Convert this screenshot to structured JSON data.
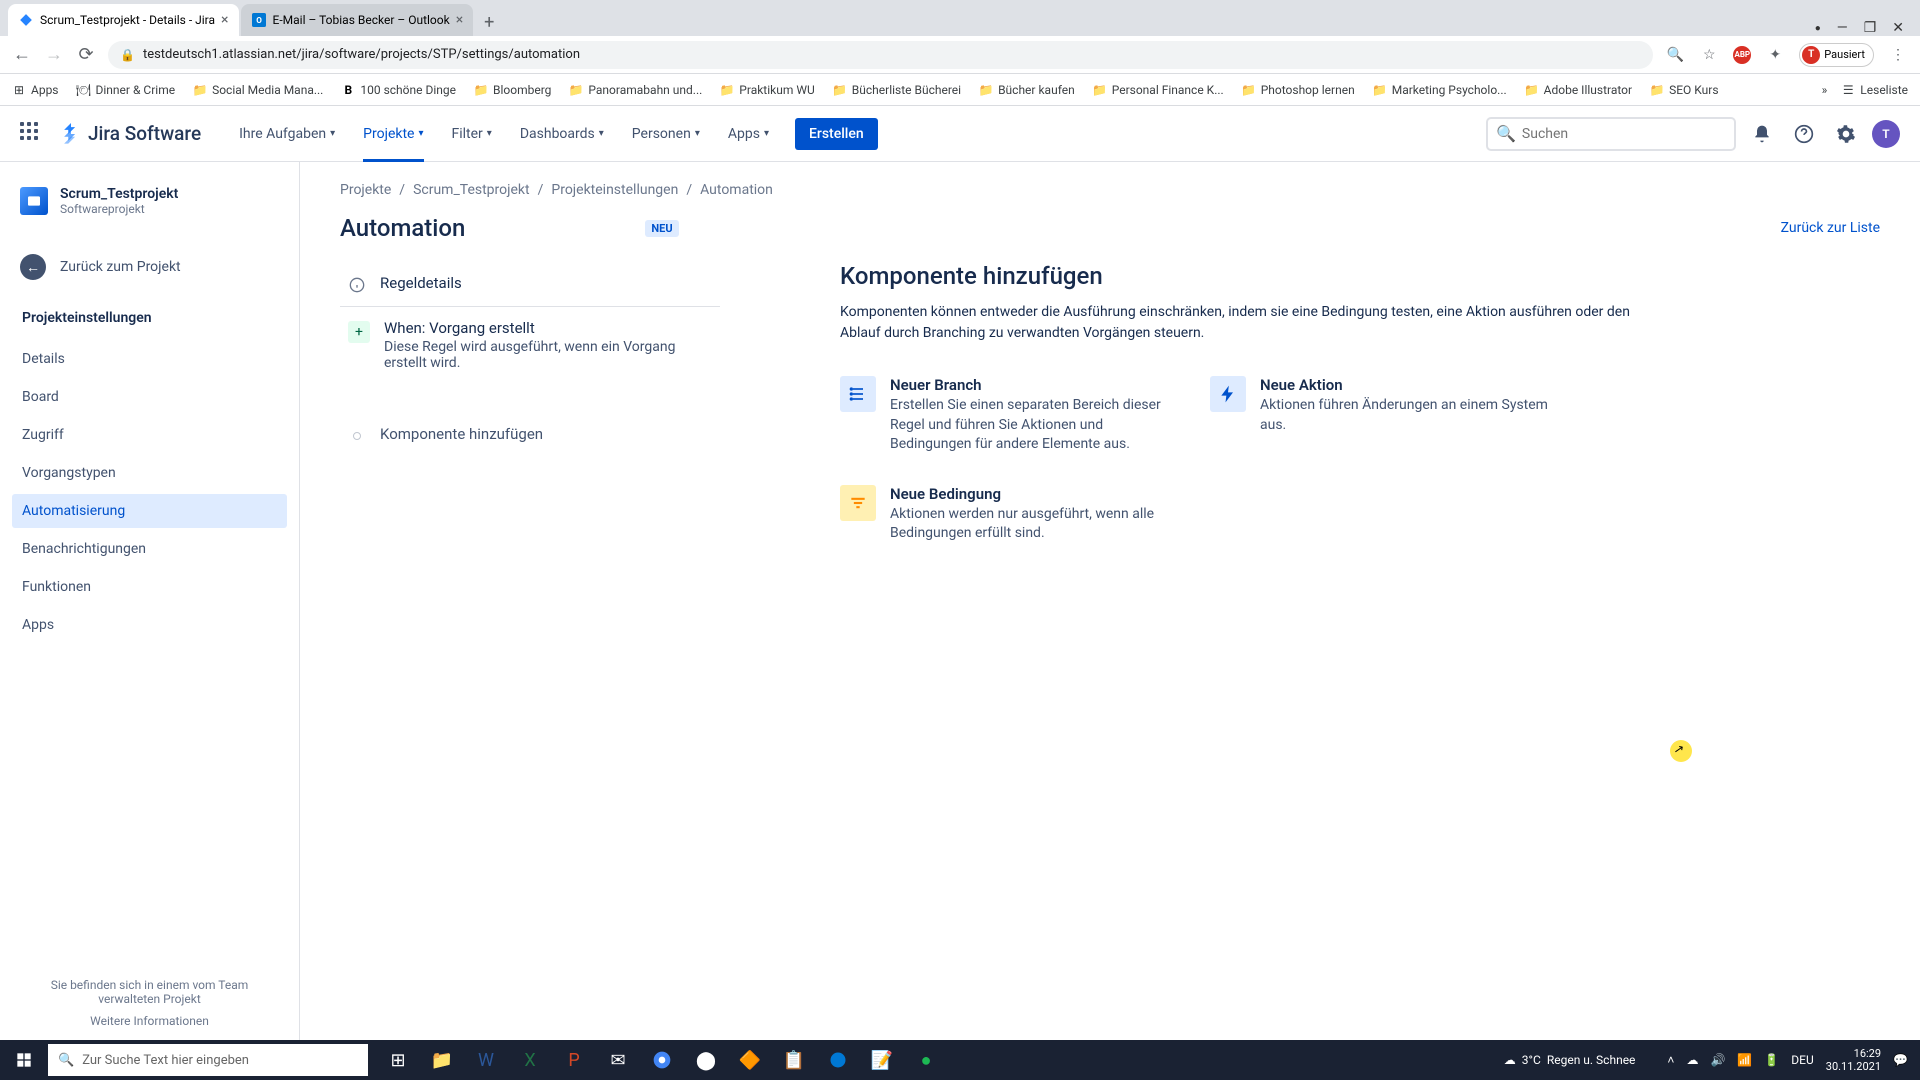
{
  "browser": {
    "tabs": [
      {
        "title": "Scrum_Testprojekt - Details - Jira"
      },
      {
        "title": "E-Mail – Tobias Becker – Outlook"
      }
    ],
    "url": "testdeutsch1.atlassian.net/jira/software/projects/STP/settings/automation",
    "profile_status": "Pausiert",
    "bookmarks": [
      "Apps",
      "Dinner & Crime",
      "Social Media Mana...",
      "100 schöne Dinge",
      "Bloomberg",
      "Panoramabahn und...",
      "Praktikum WU",
      "Bücherliste Bücherei",
      "Bücher kaufen",
      "Personal Finance K...",
      "Photoshop lernen",
      "Marketing Psycholo...",
      "Adobe Illustrator",
      "SEO Kurs"
    ],
    "reading_list": "Leseliste"
  },
  "header": {
    "logo": "Jira Software",
    "nav": [
      "Ihre Aufgaben",
      "Projekte",
      "Filter",
      "Dashboards",
      "Personen",
      "Apps"
    ],
    "active_nav_index": 1,
    "create": "Erstellen",
    "search_placeholder": "Suchen",
    "avatar_initial": "T"
  },
  "sidebar": {
    "project_name": "Scrum_Testprojekt",
    "project_type": "Softwareprojekt",
    "back": "Zurück zum Projekt",
    "section": "Projekteinstellungen",
    "items": [
      "Details",
      "Board",
      "Zugriff",
      "Vorgangstypen",
      "Automatisierung",
      "Benachrichtigungen",
      "Funktionen",
      "Apps"
    ],
    "active_index": 4,
    "footer_line": "Sie befinden sich in einem vom Team verwalteten Projekt",
    "footer_link": "Weitere Informationen"
  },
  "breadcrumb": [
    "Projekte",
    "Scrum_Testprojekt",
    "Projekteinstellungen",
    "Automation"
  ],
  "page": {
    "title": "Automation",
    "badge": "NEU",
    "back_to_list": "Zurück zur Liste"
  },
  "rule": {
    "details_label": "Regeldetails",
    "trigger_title": "When: Vorgang erstellt",
    "trigger_desc": "Diese Regel wird ausgeführt, wenn ein Vorgang erstellt wird.",
    "add_component": "Komponente hinzufügen"
  },
  "detail": {
    "title": "Komponente hinzufügen",
    "description": "Komponenten können entweder die Ausführung einschränken, indem sie eine Bedingung testen, eine Aktion ausführen oder den Ablauf durch Branching zu verwandten Vorgängen steuern.",
    "cards": [
      {
        "title": "Neuer Branch",
        "desc": "Erstellen Sie einen separaten Bereich dieser Regel und führen Sie Aktionen und Bedingungen für andere Elemente aus."
      },
      {
        "title": "Neue Aktion",
        "desc": "Aktionen führen Änderungen an einem System aus."
      },
      {
        "title": "Neue Bedingung",
        "desc": "Aktionen werden nur ausgeführt, wenn alle Bedingungen erfüllt sind."
      }
    ]
  },
  "taskbar": {
    "search_placeholder": "Zur Suche Text hier eingeben",
    "weather_temp": "3°C",
    "weather_text": "Regen u. Schnee",
    "lang": "DEU",
    "time": "16:29",
    "date": "30.11.2021"
  }
}
